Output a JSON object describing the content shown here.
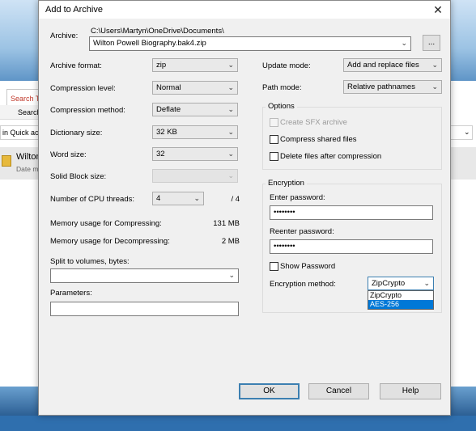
{
  "background": {
    "tab_label": "Search To",
    "ribbon_label": "Search",
    "address_text": "in Quick ac",
    "file_name": "Wilton",
    "file_meta": "Date m"
  },
  "dialog": {
    "title": "Add to Archive",
    "close_icon": "close-icon",
    "archive_label": "Archive:",
    "archive_path": "C:\\Users\\Martyn\\OneDrive\\Documents\\",
    "archive_name": "Wilton Powell Biography.bak4.zip",
    "browse_label": "...",
    "left": {
      "format_label": "Archive format:",
      "format_value": "zip",
      "level_label": "Compression level:",
      "level_value": "Normal",
      "method_label": "Compression method:",
      "method_value": "Deflate",
      "dict_label": "Dictionary size:",
      "dict_value": "32 KB",
      "word_label": "Word size:",
      "word_value": "32",
      "solid_label": "Solid Block size:",
      "solid_value": "",
      "threads_label": "Number of CPU threads:",
      "threads_value": "4",
      "threads_total": "/ 4",
      "mem_comp_label": "Memory usage for Compressing:",
      "mem_comp_value": "131 MB",
      "mem_decomp_label": "Memory usage for Decompressing:",
      "mem_decomp_value": "2 MB",
      "split_label": "Split to volumes, bytes:",
      "split_value": "",
      "params_label": "Parameters:",
      "params_value": ""
    },
    "right": {
      "update_label": "Update mode:",
      "update_value": "Add and replace files",
      "path_label": "Path mode:",
      "path_value": "Relative pathnames",
      "options_title": "Options",
      "opt_sfx": "Create SFX archive",
      "opt_shared": "Compress shared files",
      "opt_delete": "Delete files after compression",
      "encryption_title": "Encryption",
      "enter_pw_label": "Enter password:",
      "enter_pw_value": "••••••••",
      "reenter_pw_label": "Reenter password:",
      "reenter_pw_value": "••••••••",
      "show_pw_label": "Show Password",
      "enc_method_label": "Encryption method:",
      "enc_method_value": "ZipCrypto",
      "enc_options": [
        "ZipCrypto",
        "AES-256"
      ]
    },
    "buttons": {
      "ok": "OK",
      "cancel": "Cancel",
      "help": "Help"
    }
  }
}
